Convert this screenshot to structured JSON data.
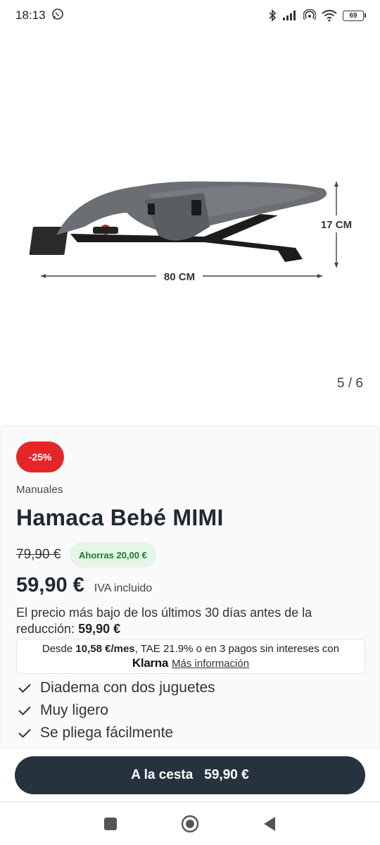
{
  "status_bar": {
    "time": "18:13",
    "battery": "69"
  },
  "gallery": {
    "dimension_width": "80 CM",
    "dimension_height": "17 CM",
    "counter": "5 / 6"
  },
  "product": {
    "badge": "-25%",
    "brand": "Manuales",
    "title": "Hamaca Bebé MIMI",
    "old_price": "79,90 €",
    "savings": "Ahorras 20,00 €",
    "price": "59,90 €",
    "vat": "IVA incluido",
    "lowest_text": "El precio más bajo de los últimos 30 días antes de la reducción:",
    "lowest_value": "59,90 €",
    "klarna": {
      "prefix": "Desde",
      "monthly": "10,58 €/mes",
      "suffix": ", TAE 21.9% o en 3 pagos sin intereses con",
      "logo": "Klarna",
      "link": "Más información"
    },
    "features": [
      "Diadema con dos juguetes",
      "Muy ligero",
      "Se pliega fácilmente"
    ]
  },
  "cart": {
    "label": "A la cesta",
    "price": "59,90 €"
  },
  "colors": {
    "badge": "#e42628",
    "savings_bg": "#e5f6e8",
    "savings_text": "#1f7a33",
    "cart_button": "#26333f"
  }
}
